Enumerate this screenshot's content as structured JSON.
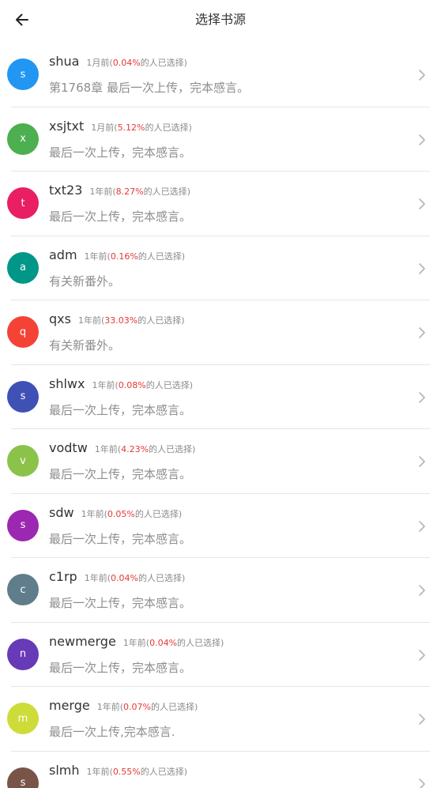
{
  "header": {
    "title": "选择书源",
    "back_icon": "arrow-left-icon"
  },
  "meta_prefix": "(",
  "meta_suffix": "的人已选择)",
  "sources": [
    {
      "initial": "s",
      "name": "shua",
      "time": "1月前",
      "percent": "0.04%",
      "chapter": "第1768章 最后一次上传，完本感言。",
      "color": "#2196F3"
    },
    {
      "initial": "x",
      "name": "xsjtxt",
      "time": "1月前",
      "percent": "5.12%",
      "chapter": "最后一次上传，完本感言。",
      "color": "#4CAF50"
    },
    {
      "initial": "t",
      "name": "txt23",
      "time": "1年前",
      "percent": "8.27%",
      "chapter": "最后一次上传，完本感言。",
      "color": "#E91E63"
    },
    {
      "initial": "a",
      "name": "adm",
      "time": "1年前",
      "percent": "0.16%",
      "chapter": "有关新番外。",
      "color": "#009688"
    },
    {
      "initial": "q",
      "name": "qxs",
      "time": "1年前",
      "percent": "33.03%",
      "chapter": "有关新番外。",
      "color": "#F44336"
    },
    {
      "initial": "s",
      "name": "shlwx",
      "time": "1年前",
      "percent": "0.08%",
      "chapter": "最后一次上传，完本感言。",
      "color": "#3F51B5"
    },
    {
      "initial": "v",
      "name": "vodtw",
      "time": "1年前",
      "percent": "4.23%",
      "chapter": "最后一次上传，完本感言。",
      "color": "#8BC34A"
    },
    {
      "initial": "s",
      "name": "sdw",
      "time": "1年前",
      "percent": "0.05%",
      "chapter": "最后一次上传，完本感言。",
      "color": "#9C27B0"
    },
    {
      "initial": "c",
      "name": "c1rp",
      "time": "1年前",
      "percent": "0.04%",
      "chapter": "最后一次上传，完本感言。",
      "color": "#607D8B"
    },
    {
      "initial": "n",
      "name": "newmerge",
      "time": "1年前",
      "percent": "0.04%",
      "chapter": "最后一次上传，完本感言。",
      "color": "#673AB7"
    },
    {
      "initial": "m",
      "name": "merge",
      "time": "1年前",
      "percent": "0.07%",
      "chapter": "最后一次上传,完本感言.",
      "color": "#CDDC39"
    },
    {
      "initial": "s",
      "name": "slmh",
      "time": "1年前",
      "percent": "0.55%",
      "chapter": "",
      "color": "#795548"
    }
  ]
}
